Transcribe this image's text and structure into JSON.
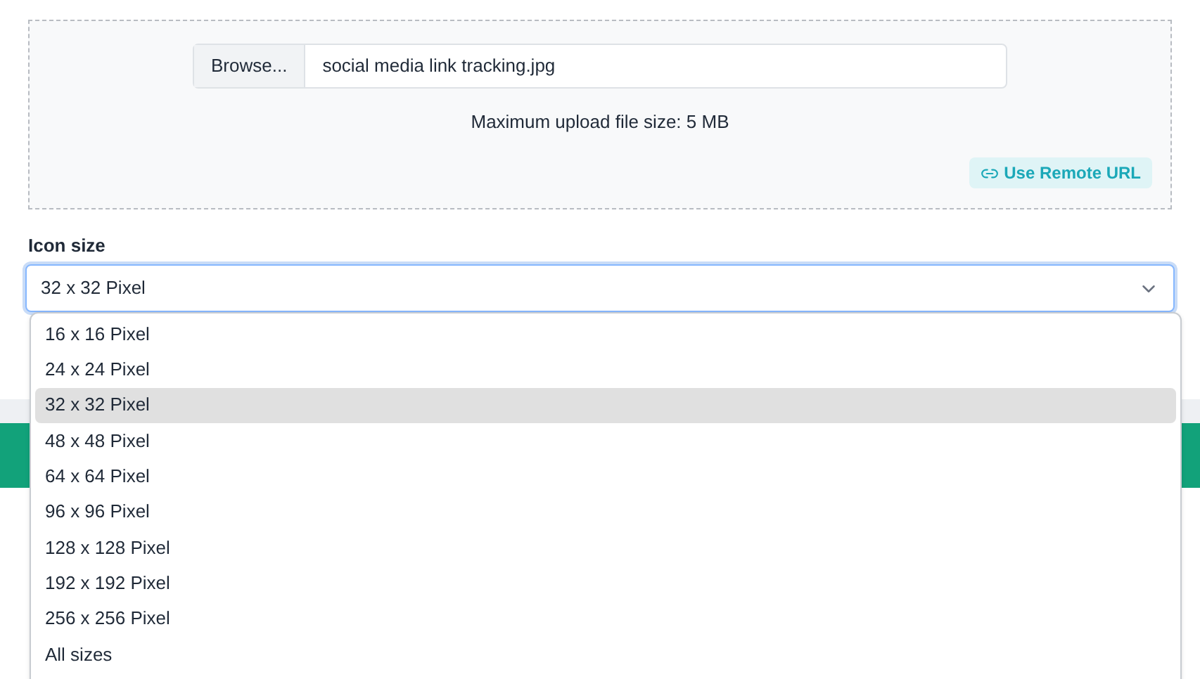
{
  "upload": {
    "browse_label": "Browse...",
    "file_name": "social media link tracking.jpg",
    "hint": "Maximum upload file size: 5 MB",
    "remote_url_label": "Use Remote URL"
  },
  "icon_size": {
    "label": "Icon size",
    "value": "32 x 32 Pixel",
    "expanded": true,
    "options": [
      {
        "label": "16 x 16 Pixel",
        "selected": false
      },
      {
        "label": "24 x 24 Pixel",
        "selected": false
      },
      {
        "label": "32 x 32 Pixel",
        "selected": true
      },
      {
        "label": "48 x 48 Pixel",
        "selected": false
      },
      {
        "label": "64 x 64 Pixel",
        "selected": false
      },
      {
        "label": "96 x 96 Pixel",
        "selected": false
      },
      {
        "label": "128 x 128 Pixel",
        "selected": false
      },
      {
        "label": "192 x 192 Pixel",
        "selected": false
      },
      {
        "label": "256 x 256 Pixel",
        "selected": false
      },
      {
        "label": "All sizes",
        "selected": false
      }
    ]
  }
}
